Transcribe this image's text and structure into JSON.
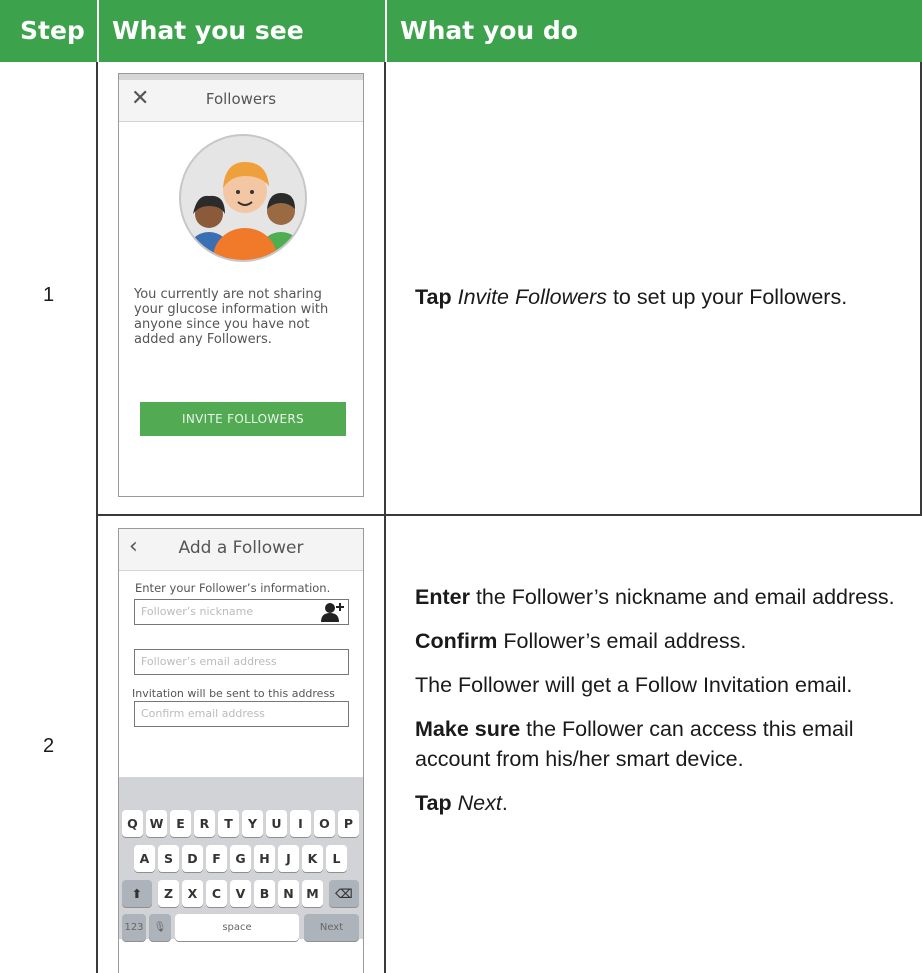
{
  "header": {
    "col_step": "Step",
    "col_see": "What you see",
    "col_do": "What you do"
  },
  "colors": {
    "header_bg": "#3da24c",
    "button_green": "#52ab52"
  },
  "rows": [
    {
      "step": "1",
      "phone": {
        "title": "Followers",
        "close_icon": "close-icon",
        "message": "You currently are not sharing your glucose information with anyone since you have not added any Followers.",
        "button": "INVITE FOLLOWERS"
      },
      "instructions": {
        "tap": "Tap",
        "tap_target": "Invite Followers",
        "tap_rest": " to set up your Followers."
      }
    },
    {
      "step": "2",
      "phone": {
        "title": "Add a Follower",
        "back_icon": "chevron-left-icon",
        "instruction": "Enter your Follower’s information.",
        "nickname_placeholder": "Follower’s nickname",
        "email_placeholder": "Follower’s email address",
        "note": "Invitation will be sent to this address",
        "confirm_placeholder": "Confirm email address",
        "keyboard": {
          "row1": [
            "Q",
            "W",
            "E",
            "R",
            "T",
            "Y",
            "U",
            "I",
            "O",
            "P"
          ],
          "row2": [
            "A",
            "S",
            "D",
            "F",
            "G",
            "H",
            "J",
            "K",
            "L"
          ],
          "row3": [
            "Z",
            "X",
            "C",
            "V",
            "B",
            "N",
            "M"
          ],
          "num": "123",
          "space": "space",
          "next": "Next"
        }
      },
      "instructions": {
        "l1_b": "Enter",
        "l1_r": " the Follower’s nickname and email address.",
        "l2_b": "Confirm",
        "l2_r": " Follower’s email address.",
        "l3": "The Follower will get a Follow Invitation email.",
        "l4_b": "Make sure",
        "l4_r": " the Follower can access this email account from his/her smart device.",
        "l5_b": "Tap",
        "l5_i": "Next",
        "l5_r": "."
      }
    }
  ]
}
